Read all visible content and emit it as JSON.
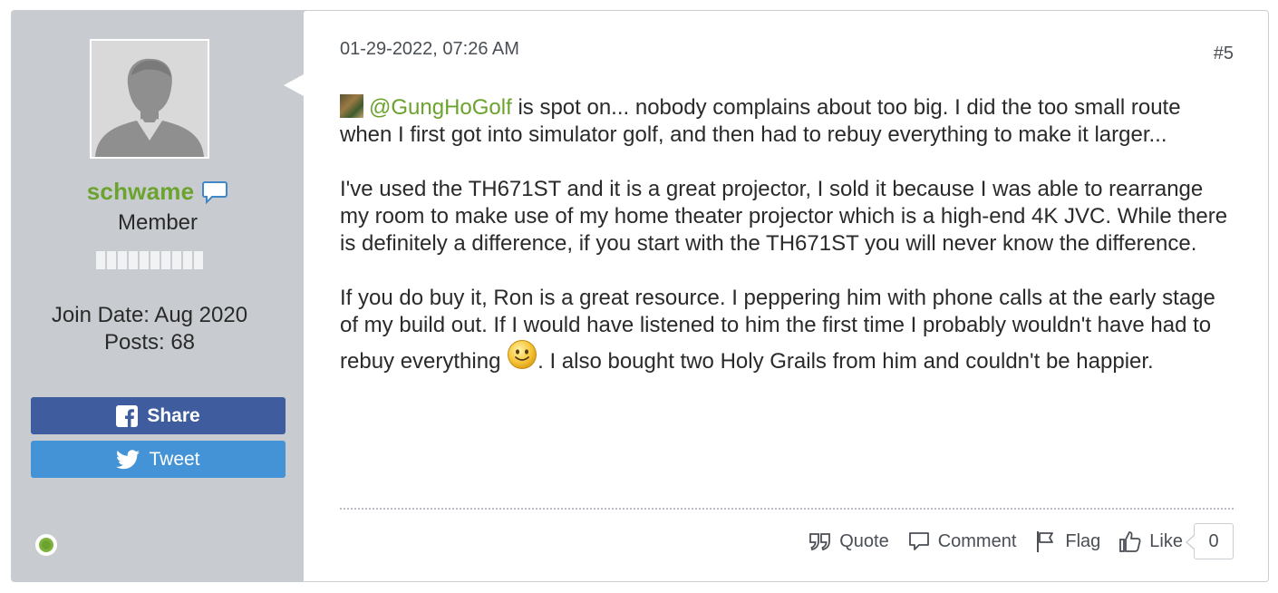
{
  "user": {
    "username": "schwame",
    "rank": "Member",
    "join_date": "Join Date: Aug 2020",
    "posts": "Posts: 68",
    "online": true,
    "icons": {
      "avatar": "default-user-avatar",
      "message": "speech-bubble-icon",
      "online": "online-status-dot"
    }
  },
  "social": {
    "share_label": "Share",
    "tweet_label": "Tweet",
    "share_color": "#3f5d9e",
    "tweet_color": "#4393d6"
  },
  "post": {
    "date": "01-29-2022, 07:26 AM",
    "number": "#5",
    "mention": "@GungHoGolf",
    "paragraph1_rest": " is spot on... nobody complains about too big. I did the too small route when I first got into simulator golf, and then had to rebuy everything to make it larger...",
    "paragraph2": "I've used the TH671ST and it is a great projector, I sold it because I was able to rearrange my room to make use of my home theater projector which is a high-end 4K JVC. While there is definitely a difference, if you start with the TH671ST you will never know the difference.",
    "paragraph3_part1": "If you do buy it, Ron is a great resource. I peppering him with phone calls at the early stage of my build out. If I would have listened to him the first time I probably wouldn't have had to rebuy everything ",
    "paragraph3_part2": ". I also bought two Holy Grails from him and couldn't be happier."
  },
  "actions": {
    "quote": "Quote",
    "comment": "Comment",
    "flag": "Flag",
    "like": "Like",
    "like_count": "0"
  },
  "colors": {
    "accent_green": "#6ba32e",
    "panel_gray": "#c8ccd0"
  }
}
